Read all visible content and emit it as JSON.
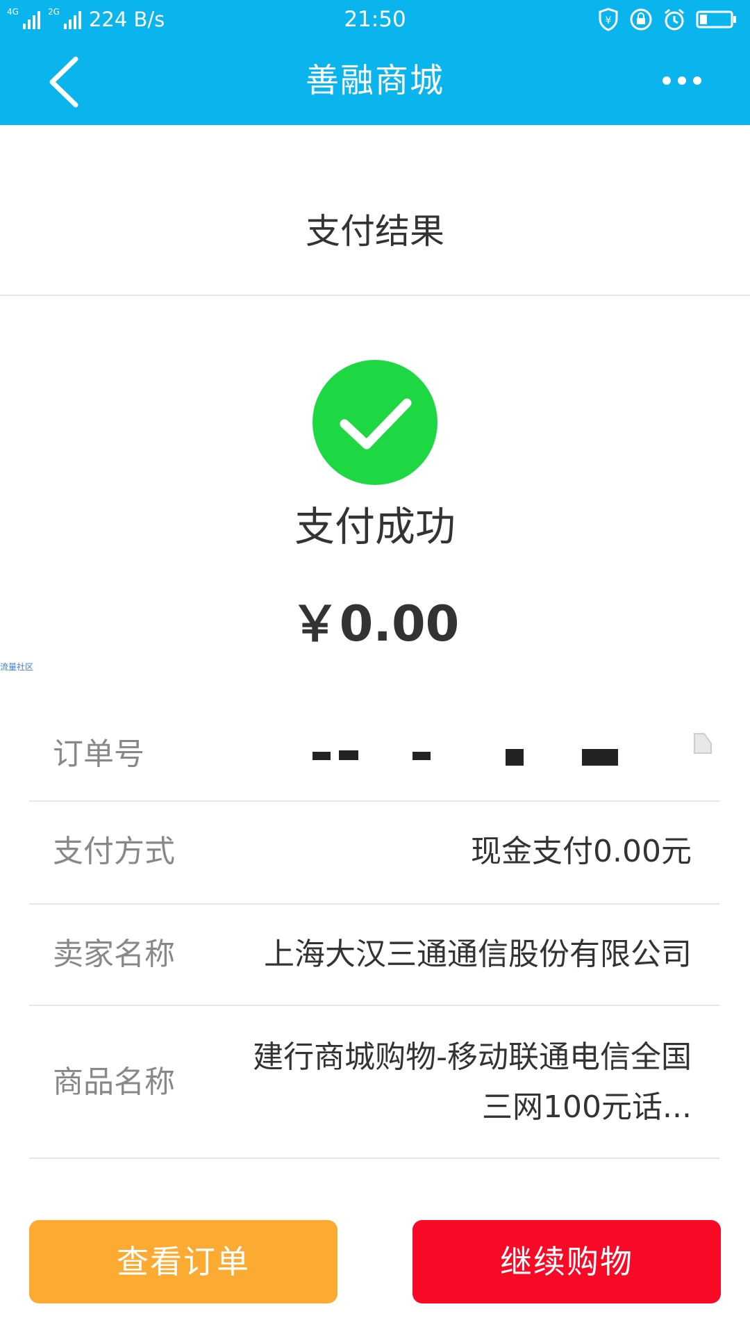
{
  "status_bar": {
    "network_left": "4G",
    "network_right": "2G",
    "speed": "224 B/s",
    "time": "21:50",
    "icons": [
      "shield-yen-icon",
      "lock-icon",
      "alarm-icon",
      "battery-icon"
    ]
  },
  "nav": {
    "title": "善融商城",
    "back_icon": "chevron-left-icon",
    "more_icon": "more-dots-icon"
  },
  "section": {
    "title": "支付结果"
  },
  "result": {
    "status": "支付成功",
    "amount": "￥0.00",
    "icon": "check-circle-icon",
    "icon_color": "#1ed843"
  },
  "watermark": "流量社区",
  "details": {
    "order_no_label": "订单号",
    "pay_method_label": "支付方式",
    "pay_method_value": "现金支付0.00元",
    "seller_label": "卖家名称",
    "seller_value": "上海大汉三通通信股份有限公司",
    "product_label": "商品名称",
    "product_value": "建行商城购物-移动联通电信全国三网100元话..."
  },
  "buttons": {
    "view_order": "查看订单",
    "continue_shopping": "继续购物"
  },
  "colors": {
    "header": "#0ab4ec",
    "view_order_bg": "#fbab32",
    "continue_bg": "#f80a26"
  }
}
